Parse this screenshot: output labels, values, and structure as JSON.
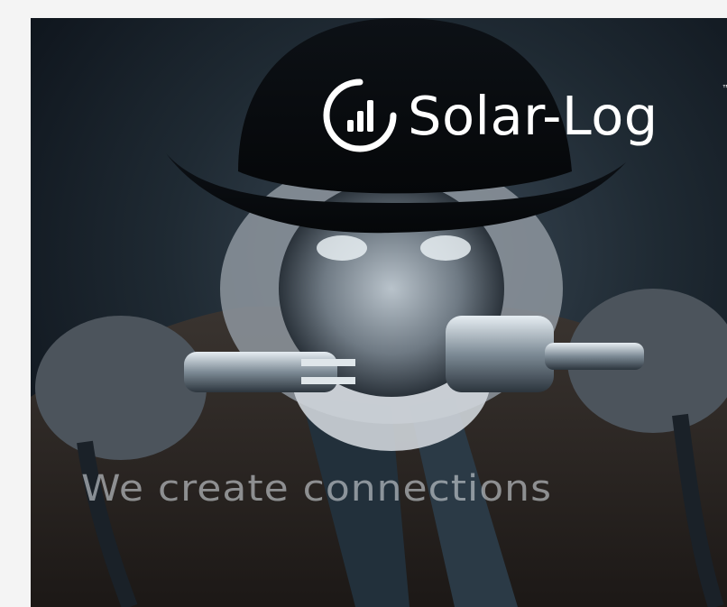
{
  "advertisement": {
    "brand_name": "Solar-Log",
    "trademark": "™",
    "tagline": "We create connections",
    "logo_icon": "bar-chart-circle-icon",
    "photo": "man-in-cowboy-hat-connecting-power-plugs"
  },
  "colors": {
    "page_background": "#f4f4f4",
    "banner_background": "#1a232c",
    "logo_text": "#ffffff",
    "tagline_text": "#cdd2d6"
  }
}
